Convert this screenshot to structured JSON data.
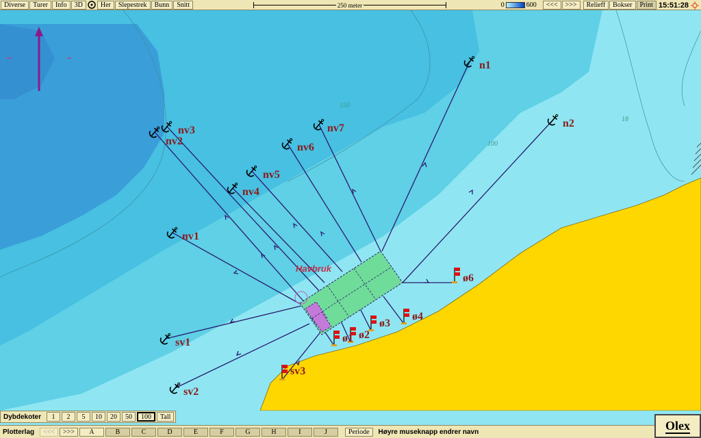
{
  "toolbar": {
    "buttons": [
      "Diverse",
      "Turer",
      "Info",
      "3D",
      "Her",
      "Slepestrek",
      "Bunn",
      "Snitt"
    ],
    "scale_label": "250 meter",
    "depth_min": "0",
    "depth_max": "600",
    "nav_back": "<<<",
    "nav_forward": ">>>",
    "relieff": "Relieff",
    "bokser": "Bokser",
    "print": "Print",
    "time": "15:51:28"
  },
  "map": {
    "farm_label": "Havbruk",
    "contour_labels": [
      "150",
      "100",
      "18"
    ],
    "anchors": [
      {
        "label": "n1"
      },
      {
        "label": "n2"
      },
      {
        "label": "nv7"
      },
      {
        "label": "nv6"
      },
      {
        "label": "nv5"
      },
      {
        "label": "nv4"
      },
      {
        "label": "nv3"
      },
      {
        "label": "nv2"
      },
      {
        "label": "nv1"
      },
      {
        "label": "sv1"
      },
      {
        "label": "sv2"
      }
    ],
    "flags": [
      {
        "label": "ø6"
      },
      {
        "label": "ø4"
      },
      {
        "label": "ø3"
      },
      {
        "label": "ø2"
      },
      {
        "label": "ø1"
      },
      {
        "label": "sv3"
      }
    ],
    "colors": {
      "land": "#ffd700",
      "shallow": "#8fe6f2",
      "mid": "#5fd0e6",
      "deep": "#3fb0dc",
      "deepest": "#3090d0",
      "lines": "#2a1a6e",
      "farm_grid": "#6fdc9a",
      "farm_extra": "#c47ad8",
      "labels": "#8b1a1a"
    }
  },
  "dybdekoter": {
    "label": "Dybdekoter",
    "values": [
      "1",
      "2",
      "5",
      "10",
      "20",
      "50",
      "100"
    ],
    "active": "100",
    "tall": "Tall"
  },
  "plotterlag": {
    "label": "Plotterlag",
    "prev": "<<<",
    "next": ">>>",
    "layers": [
      "A",
      "B",
      "C",
      "D",
      "E",
      "F",
      "G",
      "H",
      "I",
      "J"
    ],
    "periode": "Periode",
    "hint": "Høyre museknapp endrer navn"
  },
  "brand": "Olex"
}
